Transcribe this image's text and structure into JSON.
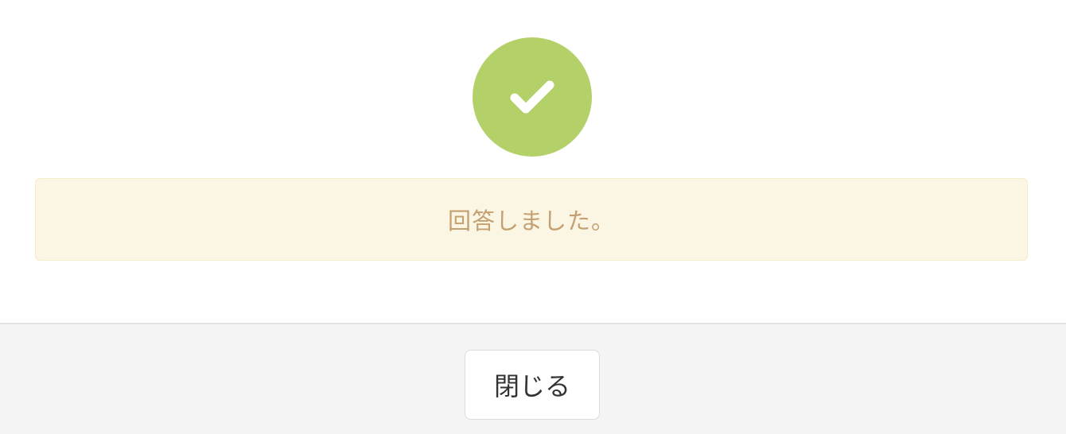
{
  "dialog": {
    "status_icon": "check-icon",
    "status_color": "#b3d168",
    "message": "回答しました。",
    "message_color": "#c4a070",
    "message_background": "#fbf6e4",
    "close_label": "閉じる"
  }
}
